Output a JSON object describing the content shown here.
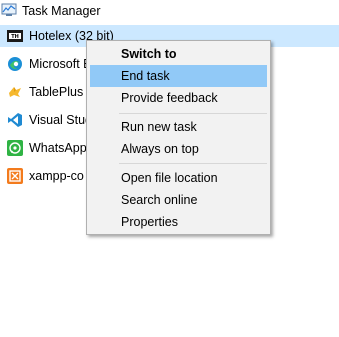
{
  "app_title": "Task Manager",
  "processes": [
    {
      "label": "Hotelex (32 bit)",
      "icon": "hotelex-icon",
      "selected": true
    },
    {
      "label": "Microsoft E",
      "icon": "edge-icon"
    },
    {
      "label": "TablePlus",
      "icon": "tableplus-icon"
    },
    {
      "label": "Visual Stud",
      "icon": "vscode-icon"
    },
    {
      "label": "WhatsApp",
      "icon": "whatsapp-icon"
    },
    {
      "label": "xampp-co",
      "icon": "xampp-icon"
    }
  ],
  "context_menu": {
    "items": [
      {
        "label": "Switch to",
        "bold": true
      },
      {
        "label": "End task",
        "highlighted": true
      },
      {
        "label": "Provide feedback"
      },
      {
        "label": "Run new task"
      },
      {
        "label": "Always on top"
      },
      {
        "label": "Open file location"
      },
      {
        "label": "Search online"
      },
      {
        "label": "Properties"
      }
    ]
  },
  "colors": {
    "selected_row": "#cce8ff",
    "menu_highlight": "#91c9f7",
    "menu_background": "#f2f2f2"
  }
}
